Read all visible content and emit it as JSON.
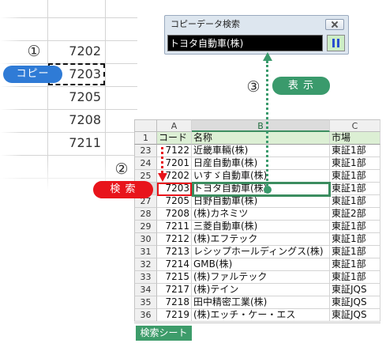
{
  "steps": {
    "copy": "①",
    "search": "②",
    "display": "③"
  },
  "labels": {
    "copy": "コピー",
    "search": "検 索",
    "display": "表 示"
  },
  "mini_grid": {
    "values": [
      "7202",
      "7203",
      "7205",
      "7208",
      "7211"
    ]
  },
  "window": {
    "title": "コピーデータ検索",
    "search_value": "トヨタ自動車(株)",
    "close_icon": "close-icon",
    "button_icon": "pause-icon"
  },
  "sheet": {
    "column_letters": [
      "A",
      "B",
      "C"
    ],
    "header_row": {
      "row": "1",
      "code": "コード",
      "name": "名称",
      "market": "市場"
    },
    "rows": [
      {
        "row": "23",
        "code": "7122",
        "name": "近畿車輛(株)",
        "market": "東証1部"
      },
      {
        "row": "24",
        "code": "7201",
        "name": "日産自動車(株)",
        "market": "東証1部"
      },
      {
        "row": "25",
        "code": "7202",
        "name": "いすゞ自動車(株)",
        "market": "東証1部"
      },
      {
        "row": "26",
        "code": "7203",
        "name": "トヨタ自動車(株)",
        "market": "東証1部"
      },
      {
        "row": "27",
        "code": "7205",
        "name": "日野自動車(株)",
        "market": "東証1部"
      },
      {
        "row": "28",
        "code": "7208",
        "name": "(株)カネミツ",
        "market": "東証2部"
      },
      {
        "row": "29",
        "code": "7211",
        "name": "三菱自動車(株)",
        "market": "東証1部"
      },
      {
        "row": "30",
        "code": "7212",
        "name": "(株)エフテック",
        "market": "東証1部"
      },
      {
        "row": "31",
        "code": "7213",
        "name": "レシップホールディングス(株)",
        "market": "東証1部"
      },
      {
        "row": "32",
        "code": "7214",
        "name": "GMB(株)",
        "market": "東証1部"
      },
      {
        "row": "33",
        "code": "7215",
        "name": "(株)ファルテック",
        "market": "東証1部"
      },
      {
        "row": "34",
        "code": "7217",
        "name": "(株)テイン",
        "market": "東証JQS"
      },
      {
        "row": "35",
        "code": "7218",
        "name": "田中精密工業(株)",
        "market": "東証JQS"
      },
      {
        "row": "36",
        "code": "7219",
        "name": "(株)エッチ・ケー・エス",
        "market": "東証JQS"
      }
    ]
  },
  "sheet_tab": "検索シート",
  "colors": {
    "copy_accent": "#2f7bd6",
    "search_accent": "#e8141b",
    "display_accent": "#3a9a6c",
    "selection_green": "#3c8d60",
    "header_fill": "#dcefd4"
  }
}
